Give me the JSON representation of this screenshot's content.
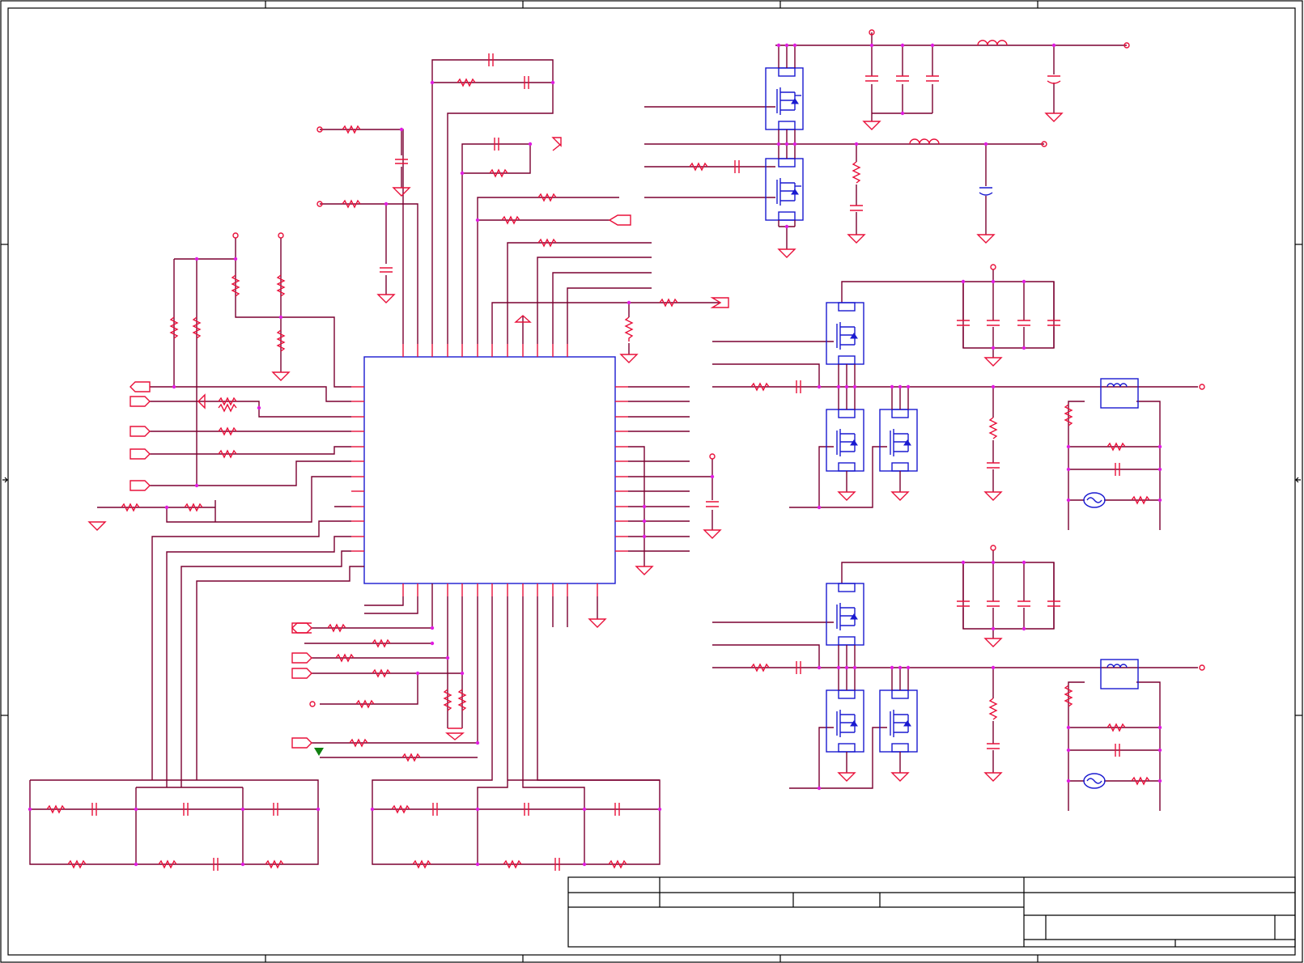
{
  "sheet": {
    "colors": {
      "wire": "#7a0030",
      "component": "#e8103a",
      "device": "#1a1ad0",
      "junction": "#e01ce0",
      "frame": "#000000",
      "marker": "#108010"
    }
  }
}
